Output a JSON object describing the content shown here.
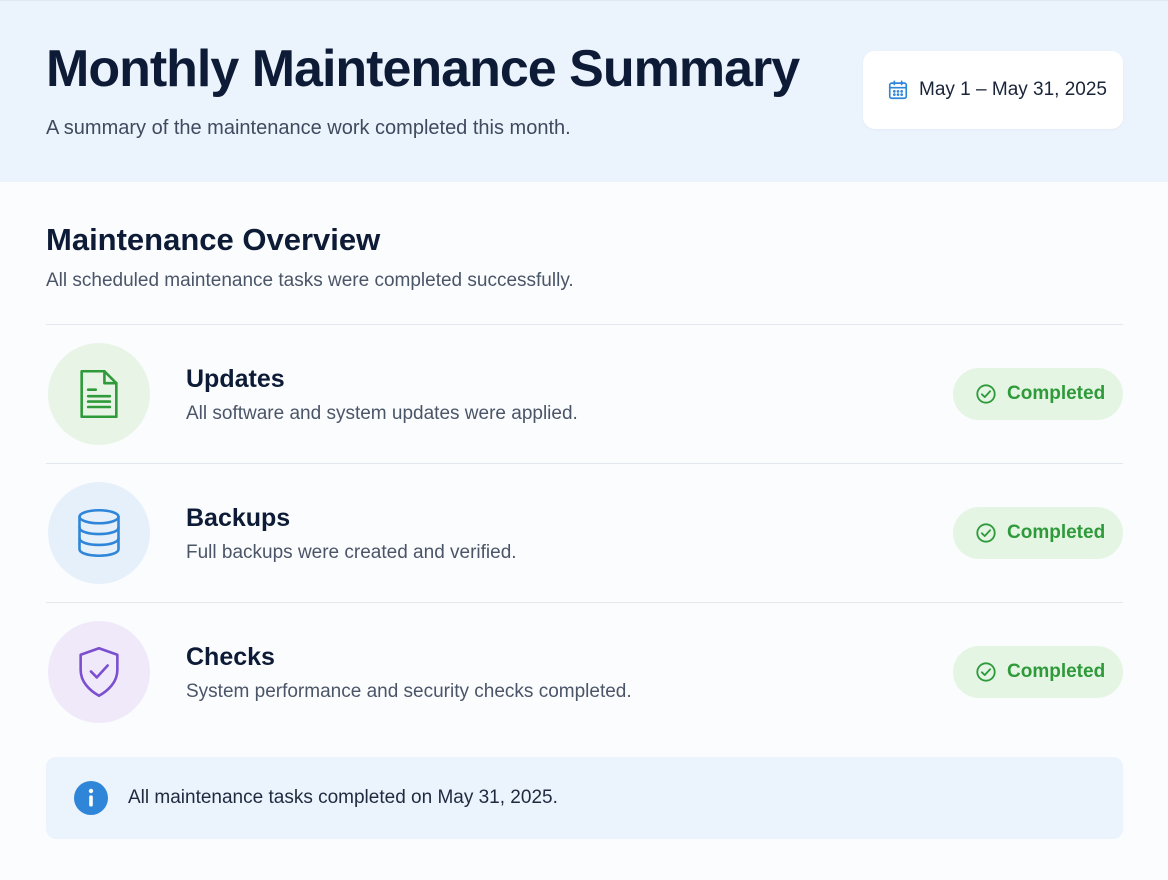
{
  "header": {
    "title": "Monthly Maintenance Summary",
    "subtitle": "A summary of the maintenance work completed this month.",
    "date_range": "May 1 – May 31, 2025",
    "date_icon": "calendar-icon"
  },
  "overview": {
    "title": "Maintenance Overview",
    "description": "All scheduled maintenance tasks were completed successfully."
  },
  "items": [
    {
      "title": "Updates",
      "description": "All software and system updates were applied.",
      "icon": "document-icon",
      "icon_color": "#2e9a3a",
      "icon_bg": "#e8f5e6",
      "status": "Completed"
    },
    {
      "title": "Backups",
      "description": "Full backups were created and verified.",
      "icon": "database-icon",
      "icon_color": "#2f86d9",
      "icon_bg": "#e6f0fb",
      "status": "Completed"
    },
    {
      "title": "Checks",
      "description": "System performance and security checks completed.",
      "icon": "shield-check-icon",
      "icon_color": "#7b4fd0",
      "icon_bg": "#efe9fa",
      "status": "Completed"
    }
  ],
  "status_color": "#2e9a3a",
  "status_bg": "#e5f5e4",
  "footer_note": {
    "text": "All maintenance tasks completed on May 31, 2025.",
    "icon": "info-icon",
    "icon_color": "#2f86d9"
  }
}
